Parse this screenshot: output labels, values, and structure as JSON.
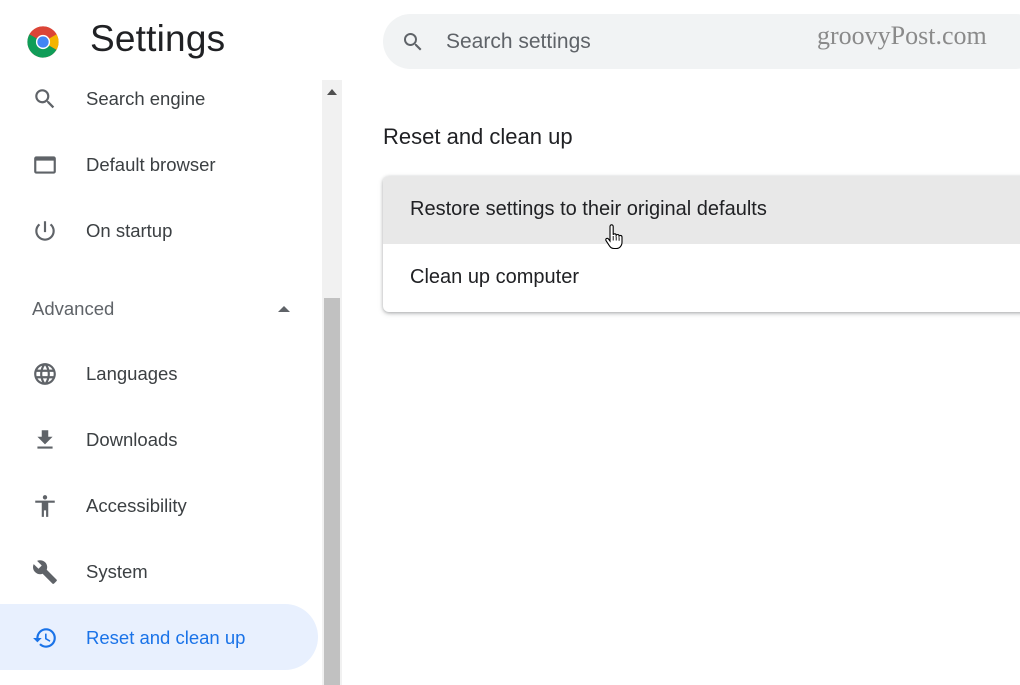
{
  "header": {
    "title": "Settings",
    "search_placeholder": "Search settings",
    "watermark": "groovyPost.com"
  },
  "sidebar": {
    "items_top": [
      {
        "label": "Search engine",
        "icon": "search-icon"
      },
      {
        "label": "Default browser",
        "icon": "browser-window-icon"
      },
      {
        "label": "On startup",
        "icon": "power-icon"
      }
    ],
    "advanced_label": "Advanced",
    "advanced_expanded": true,
    "items_advanced": [
      {
        "label": "Languages",
        "icon": "globe-icon"
      },
      {
        "label": "Downloads",
        "icon": "download-icon"
      },
      {
        "label": "Accessibility",
        "icon": "accessibility-icon"
      },
      {
        "label": "System",
        "icon": "wrench-icon"
      },
      {
        "label": "Reset and clean up",
        "icon": "history-icon",
        "active": true
      }
    ]
  },
  "main": {
    "section_title": "Reset and clean up",
    "options": [
      {
        "label": "Restore settings to their original defaults",
        "hovered": true
      },
      {
        "label": "Clean up computer",
        "hovered": false
      }
    ]
  },
  "colors": {
    "accent": "#1a73e8",
    "active_bg": "#e8f0fe",
    "icon": "#5f6368",
    "hover_row": "#e8e8e8"
  }
}
